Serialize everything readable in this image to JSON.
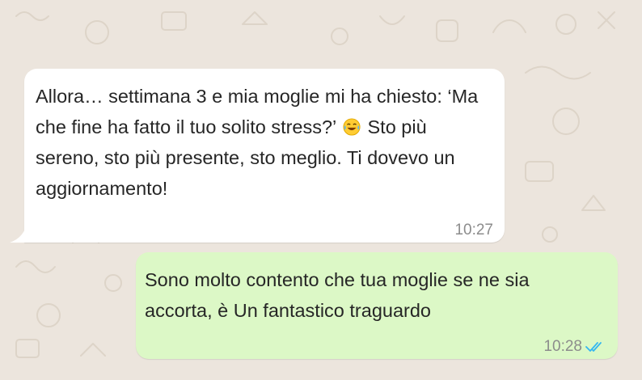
{
  "chat": {
    "incoming_message": {
      "text_before_emoji": "Allora… settimana 3 e mia moglie mi ha chiesto: ‘Ma che fine ha fatto il tuo solito stress?’",
      "emoji_icon": "face-with-tears-of-joy-icon",
      "text_after_emoji": "Sto più sereno, sto più presente, sto meglio. Ti dovevo un aggiornamento!",
      "time": "10:27",
      "bubble_color": "#ffffff"
    },
    "outgoing_message": {
      "text": "Sono molto contento che tua moglie se ne sia accorta, è Un fantastico traguardo",
      "time": "10:28",
      "status_icon": "double-check-read-icon",
      "status_color": "#34b7f1",
      "bubble_color": "#dcf8c6"
    },
    "wallpaper_color": "#ece5dd"
  }
}
